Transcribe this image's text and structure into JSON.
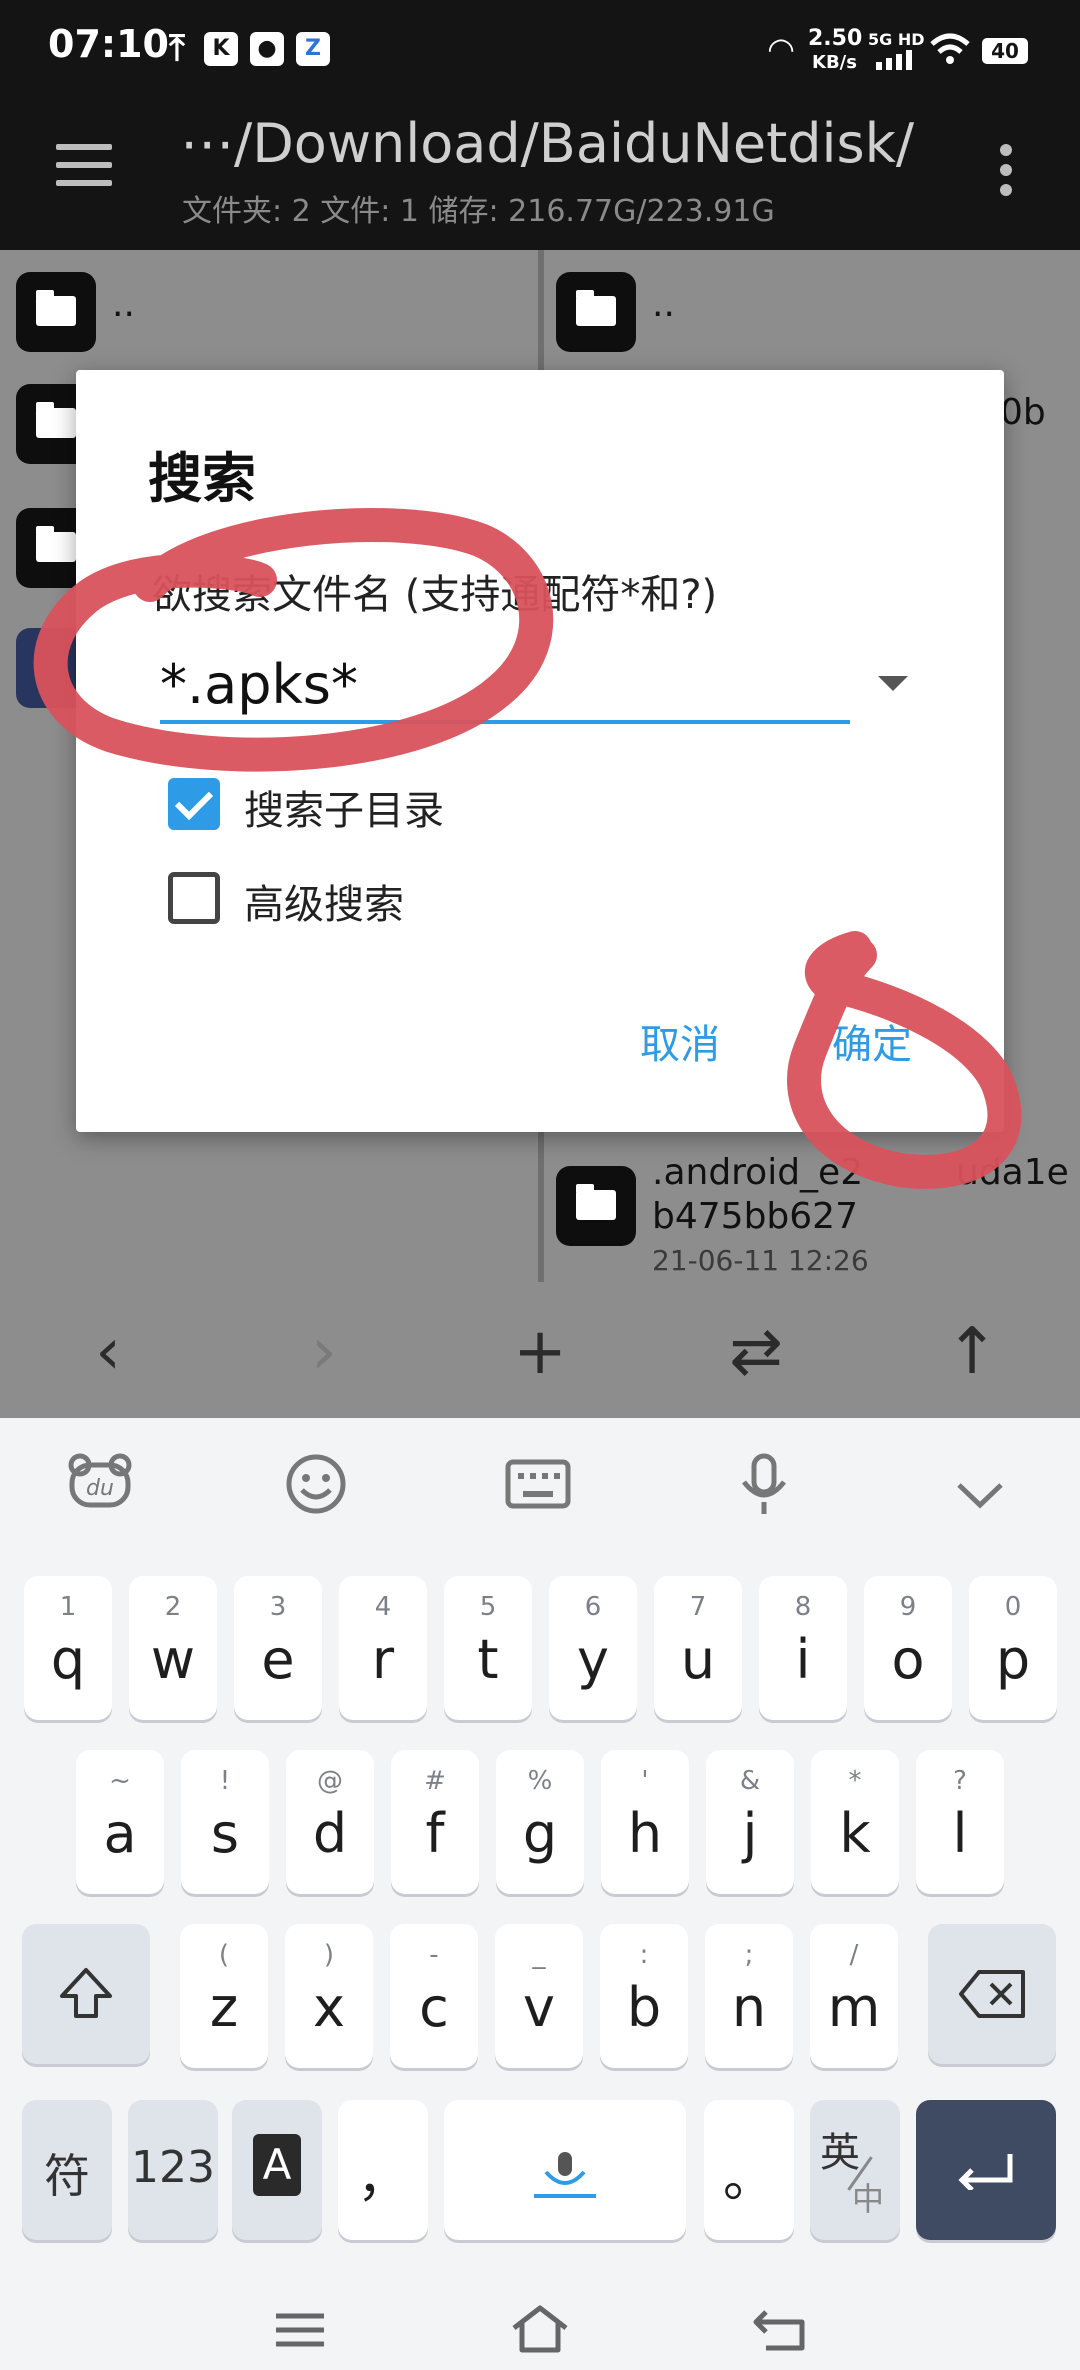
{
  "status_bar": {
    "time": "07:10",
    "speed_value": "2.50",
    "speed_unit": "KB/s",
    "network": "5G HD",
    "battery": "40",
    "notification_icons": [
      "upload-icon",
      "app-k-icon",
      "qq-icon",
      "app-blue-icon"
    ]
  },
  "app_bar": {
    "path": "⋯/Download/BaiduNetdisk/",
    "info": "文件夹: 2  文件: 1  储存: 216.77G/223.91G",
    "menu_icon": "hamburger-menu-icon",
    "overflow_icon": "more-vert-icon"
  },
  "file_pane_left": {
    "items": [
      {
        "name": ".."
      }
    ]
  },
  "file_pane_right": {
    "items": [
      {
        "name": ".."
      },
      {
        "name": "0b"
      },
      {
        "name": ".android_e2",
        "name_tail": "uda1e",
        "name_line2": "b475bb627",
        "date": "21-06-11 12:26"
      }
    ]
  },
  "toolbar": {
    "back_icon": "‹",
    "forward_icon": "›",
    "add_icon": "+",
    "swap_icon": "⇄",
    "up_icon": "↑"
  },
  "dialog": {
    "title": "搜索",
    "input_label": "欲搜索文件名 (支持通配符*和?)",
    "input_value": "*.apks*",
    "checkbox_subdir_label": "搜索子目录",
    "checkbox_subdir_checked": true,
    "checkbox_advanced_label": "高级搜索",
    "checkbox_advanced_checked": false,
    "cancel_label": "取消",
    "ok_label": "确定"
  },
  "annotation": {
    "color": "#d9525c"
  },
  "keyboard": {
    "top_icons": [
      "baidu-du-icon",
      "emoji-icon",
      "keyboard-icon",
      "microphone-icon",
      "collapse-icon"
    ],
    "row1": [
      {
        "hint": "1",
        "key": "q"
      },
      {
        "hint": "2",
        "key": "w"
      },
      {
        "hint": "3",
        "key": "e"
      },
      {
        "hint": "4",
        "key": "r"
      },
      {
        "hint": "5",
        "key": "t"
      },
      {
        "hint": "6",
        "key": "y"
      },
      {
        "hint": "7",
        "key": "u"
      },
      {
        "hint": "8",
        "key": "i"
      },
      {
        "hint": "9",
        "key": "o"
      },
      {
        "hint": "0",
        "key": "p"
      }
    ],
    "row2": [
      {
        "hint": "~",
        "key": "a"
      },
      {
        "hint": "!",
        "key": "s"
      },
      {
        "hint": "@",
        "key": "d"
      },
      {
        "hint": "#",
        "key": "f"
      },
      {
        "hint": "%",
        "key": "g"
      },
      {
        "hint": "'",
        "key": "h"
      },
      {
        "hint": "&",
        "key": "j"
      },
      {
        "hint": "*",
        "key": "k"
      },
      {
        "hint": "?",
        "key": "l"
      }
    ],
    "row3": [
      {
        "hint": "(",
        "key": "z"
      },
      {
        "hint": ")",
        "key": "x"
      },
      {
        "hint": "-",
        "key": "c"
      },
      {
        "hint": "_",
        "key": "v"
      },
      {
        "hint": ":",
        "key": "b"
      },
      {
        "hint": ";",
        "key": "n"
      },
      {
        "hint": "/",
        "key": "m"
      }
    ],
    "symbol_key": "符",
    "number_key": "123",
    "case_key": "A",
    "comma_key": "，",
    "period_key": "。",
    "lang_key_top": "英",
    "lang_key_bottom": "中",
    "colors": {
      "accent_key": "#3f4a63",
      "function_key": "#dfe3ea",
      "voice_accent": "#2e9be6"
    }
  },
  "nav_bar": {
    "icons": [
      "menu-icon",
      "home-icon",
      "back-icon"
    ]
  }
}
